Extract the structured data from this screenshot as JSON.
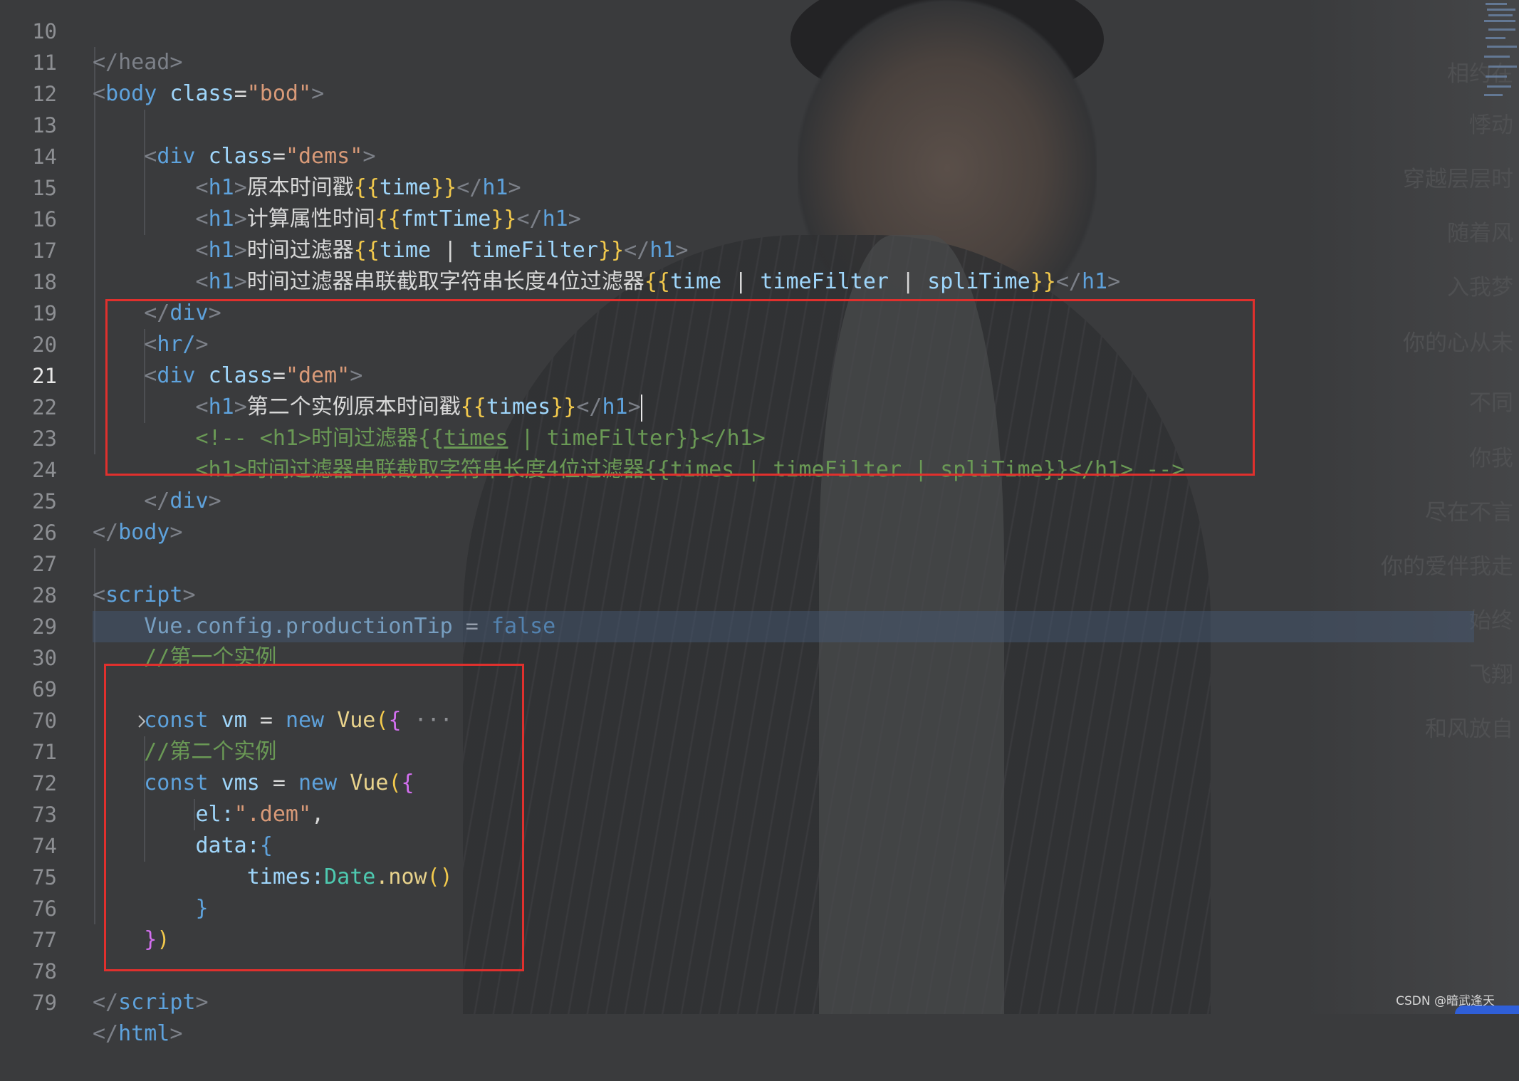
{
  "lines": [
    {
      "n": "10"
    },
    {
      "n": "11"
    },
    {
      "n": "12"
    },
    {
      "n": "13"
    },
    {
      "n": "14"
    },
    {
      "n": "15"
    },
    {
      "n": "16"
    },
    {
      "n": "17"
    },
    {
      "n": "18"
    },
    {
      "n": "19"
    },
    {
      "n": "20"
    },
    {
      "n": "21"
    },
    {
      "n": "22"
    },
    {
      "n": "23"
    },
    {
      "n": "24"
    },
    {
      "n": "25"
    },
    {
      "n": "26"
    },
    {
      "n": "27"
    },
    {
      "n": "28"
    },
    {
      "n": "29"
    },
    {
      "n": "30"
    },
    {
      "n": "69"
    },
    {
      "n": "70"
    },
    {
      "n": "71"
    },
    {
      "n": "72"
    },
    {
      "n": "73"
    },
    {
      "n": "74"
    },
    {
      "n": "75"
    },
    {
      "n": "76"
    },
    {
      "n": "77"
    },
    {
      "n": "78"
    },
    {
      "n": "79"
    }
  ],
  "code": {
    "l10": "</head>",
    "body_open": "body",
    "attr_class": "class",
    "eq": "=",
    "body_class_val": "\"bod\"",
    "div": "div",
    "dems_val": "\"dems\"",
    "h1": "h1",
    "txt14": "原本时间戳",
    "txt15": "计算属性时间",
    "txt16": "时间过滤器",
    "txt17": "时间过滤器串联截取字符串长度4位过滤器",
    "time": "time",
    "fmtTime": "fmtTime",
    "timeFilter": "timeFilter",
    "spliTime": "spliTime",
    "pipe": "|",
    "hr": "hr/",
    "dem_val": "\"dem\"",
    "txt21": "第二个实例原本时间戳",
    "times": "times",
    "c22_pre": "<!-- <h1>时间过滤器{{",
    "c22_times": "times",
    "c22_post": " | timeFilter}}</h1>",
    "c23": "<h1>时间过滤器串联截取字符串长度4位过滤器{{times | timeFilter | spliTime}}</h1> -->",
    "body_close": "body",
    "script": "script",
    "vue_config": "Vue.config.productionTip",
    "false": "false",
    "comment29": "//第一个实例",
    "const": "const",
    "vm": "vm",
    "new": "new",
    "Vue": "Vue",
    "folded": "···",
    "comment70": "//第二个实例",
    "vms": "vms",
    "el_key": "el:",
    "el_val": "\".dem\"",
    "comma": ",",
    "data_key": "data:",
    "times_key": "times:",
    "Date": "Date",
    "now": ".now",
    "html": "html"
  },
  "lyrics": [
    "相约在",
    "悸动",
    "穿越层层时",
    "随着风",
    "入我梦",
    "你的心从未",
    "不同",
    "你我",
    "尽在不言",
    "你的爱伴我走",
    "始终",
    "飞翔",
    "和风放自"
  ],
  "watermark": "CSDN @暗武逢天",
  "colors": {
    "highlight": "#e0302d",
    "keyword": "#5ea2dc",
    "string": "#d99a78",
    "comment": "#6a9955"
  }
}
